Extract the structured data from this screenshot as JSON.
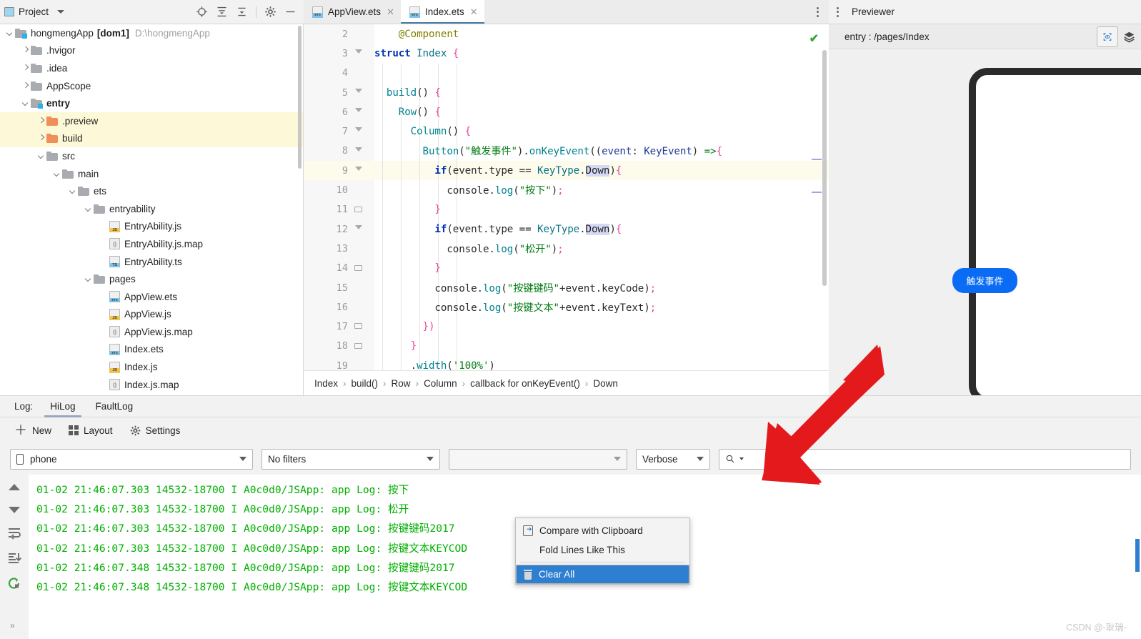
{
  "project_panel": {
    "title": "Project",
    "toolbar_icons": [
      "locate-icon",
      "expand-all-icon",
      "collapse-all-icon",
      "settings-gear-icon",
      "minimize-icon"
    ],
    "tree": [
      {
        "depth": 0,
        "arrow": "down",
        "icon": "folder-module",
        "label": "hongmengApp",
        "bold_suffix": "[dom1]",
        "path": "D:\\hongmengApp",
        "highlight": false
      },
      {
        "depth": 1,
        "arrow": "right",
        "icon": "folder",
        "label": ".hvigor",
        "highlight": false
      },
      {
        "depth": 1,
        "arrow": "right",
        "icon": "folder",
        "label": ".idea",
        "highlight": false
      },
      {
        "depth": 1,
        "arrow": "right",
        "icon": "folder",
        "label": "AppScope",
        "highlight": false
      },
      {
        "depth": 1,
        "arrow": "down",
        "icon": "folder-module",
        "label": "entry",
        "bold": true,
        "highlight": false
      },
      {
        "depth": 2,
        "arrow": "right",
        "icon": "folder-orange",
        "label": ".preview",
        "highlight": true
      },
      {
        "depth": 2,
        "arrow": "right",
        "icon": "folder-orange",
        "label": "build",
        "highlight": true
      },
      {
        "depth": 2,
        "arrow": "down",
        "icon": "folder",
        "label": "src",
        "highlight": false
      },
      {
        "depth": 3,
        "arrow": "down",
        "icon": "folder",
        "label": "main",
        "highlight": false
      },
      {
        "depth": 4,
        "arrow": "down",
        "icon": "folder",
        "label": "ets",
        "highlight": false
      },
      {
        "depth": 5,
        "arrow": "down",
        "icon": "folder",
        "label": "entryability",
        "highlight": false
      },
      {
        "depth": 6,
        "arrow": "none",
        "icon": "file-js",
        "label": "EntryAbility.js",
        "highlight": false
      },
      {
        "depth": 6,
        "arrow": "none",
        "icon": "file-map",
        "label": "EntryAbility.js.map",
        "highlight": false
      },
      {
        "depth": 6,
        "arrow": "none",
        "icon": "file-ts",
        "label": "EntryAbility.ts",
        "highlight": false
      },
      {
        "depth": 5,
        "arrow": "down",
        "icon": "folder",
        "label": "pages",
        "highlight": false
      },
      {
        "depth": 6,
        "arrow": "none",
        "icon": "file-ets",
        "label": "AppView.ets",
        "highlight": false
      },
      {
        "depth": 6,
        "arrow": "none",
        "icon": "file-js",
        "label": "AppView.js",
        "highlight": false
      },
      {
        "depth": 6,
        "arrow": "none",
        "icon": "file-map",
        "label": "AppView.js.map",
        "highlight": false
      },
      {
        "depth": 6,
        "arrow": "none",
        "icon": "file-ets",
        "label": "Index.ets",
        "highlight": false
      },
      {
        "depth": 6,
        "arrow": "none",
        "icon": "file-js",
        "label": "Index.js",
        "highlight": false
      },
      {
        "depth": 6,
        "arrow": "none",
        "icon": "file-map",
        "label": "Index.js.map",
        "highlight": false
      }
    ]
  },
  "editor": {
    "tabs": [
      {
        "label": "AppView.ets",
        "icon": "ets-file-icon",
        "active": false
      },
      {
        "label": "Index.ets",
        "icon": "ets-file-icon",
        "active": true
      }
    ],
    "status_ok": "✔",
    "lines": [
      {
        "num": "2",
        "fold": "none",
        "current": false,
        "tokens": [
          {
            "t": "    ",
            "c": "plain"
          },
          {
            "t": "@Component",
            "c": "ann"
          }
        ]
      },
      {
        "num": "3",
        "fold": "tri",
        "current": false,
        "tokens": [
          {
            "t": "struct",
            "c": "kw"
          },
          {
            "t": " ",
            "c": "plain"
          },
          {
            "t": "Index",
            "c": "type"
          },
          {
            "t": " ",
            "c": "plain"
          },
          {
            "t": "{",
            "c": "brk"
          }
        ]
      },
      {
        "num": "4",
        "fold": "none",
        "current": false,
        "tokens": []
      },
      {
        "num": "5",
        "fold": "tri",
        "current": false,
        "tokens": [
          {
            "t": "  ",
            "c": "plain"
          },
          {
            "t": "build",
            "c": "fn"
          },
          {
            "t": "() ",
            "c": "plain"
          },
          {
            "t": "{",
            "c": "brk"
          }
        ]
      },
      {
        "num": "6",
        "fold": "tri",
        "current": false,
        "tokens": [
          {
            "t": "    ",
            "c": "plain"
          },
          {
            "t": "Row",
            "c": "fn"
          },
          {
            "t": "() ",
            "c": "plain"
          },
          {
            "t": "{",
            "c": "brk"
          }
        ]
      },
      {
        "num": "7",
        "fold": "tri",
        "current": false,
        "tokens": [
          {
            "t": "      ",
            "c": "plain"
          },
          {
            "t": "Column",
            "c": "fn"
          },
          {
            "t": "() ",
            "c": "plain"
          },
          {
            "t": "{",
            "c": "brk"
          }
        ]
      },
      {
        "num": "8",
        "fold": "tri",
        "current": false,
        "tokens": [
          {
            "t": "        ",
            "c": "plain"
          },
          {
            "t": "Button",
            "c": "fn"
          },
          {
            "t": "(",
            "c": "plain"
          },
          {
            "t": "\"触发事件\"",
            "c": "str"
          },
          {
            "t": ").",
            "c": "plain"
          },
          {
            "t": "onKeyEvent",
            "c": "fn"
          },
          {
            "t": "((",
            "c": "plain"
          },
          {
            "t": "event",
            "c": "id"
          },
          {
            "t": ": ",
            "c": "plain"
          },
          {
            "t": "KeyEvent",
            "c": "id"
          },
          {
            "t": ") ",
            "c": "plain"
          },
          {
            "t": "=>",
            "c": "arr"
          },
          {
            "t": "{",
            "c": "brk"
          }
        ]
      },
      {
        "num": "9",
        "fold": "tri",
        "current": true,
        "tokens": [
          {
            "t": "          ",
            "c": "plain"
          },
          {
            "t": "if",
            "c": "kw"
          },
          {
            "t": "(",
            "c": "plain"
          },
          {
            "t": "event",
            "c": "plain"
          },
          {
            "t": ".",
            "c": "plain"
          },
          {
            "t": "type",
            "c": "plain"
          },
          {
            "t": " == ",
            "c": "plain"
          },
          {
            "t": "KeyType",
            "c": "type"
          },
          {
            "t": ".",
            "c": "plain"
          },
          {
            "t": "Down",
            "c": "sel"
          },
          {
            "t": ")",
            "c": "plain"
          },
          {
            "t": "{",
            "c": "brk"
          }
        ]
      },
      {
        "num": "10",
        "fold": "none",
        "current": false,
        "tokens": [
          {
            "t": "            ",
            "c": "plain"
          },
          {
            "t": "console",
            "c": "plain"
          },
          {
            "t": ".",
            "c": "plain"
          },
          {
            "t": "log",
            "c": "fn"
          },
          {
            "t": "(",
            "c": "plain"
          },
          {
            "t": "\"按下\"",
            "c": "str"
          },
          {
            "t": ")",
            "c": "plain"
          },
          {
            "t": ";",
            "c": "brk"
          }
        ]
      },
      {
        "num": "11",
        "fold": "minus",
        "current": false,
        "tokens": [
          {
            "t": "          ",
            "c": "plain"
          },
          {
            "t": "}",
            "c": "brk"
          }
        ]
      },
      {
        "num": "12",
        "fold": "tri",
        "current": false,
        "tokens": [
          {
            "t": "          ",
            "c": "plain"
          },
          {
            "t": "if",
            "c": "kw"
          },
          {
            "t": "(",
            "c": "plain"
          },
          {
            "t": "event",
            "c": "plain"
          },
          {
            "t": ".",
            "c": "plain"
          },
          {
            "t": "type",
            "c": "plain"
          },
          {
            "t": " == ",
            "c": "plain"
          },
          {
            "t": "KeyType",
            "c": "type"
          },
          {
            "t": ".",
            "c": "plain"
          },
          {
            "t": "Down",
            "c": "sel"
          },
          {
            "t": ")",
            "c": "plain"
          },
          {
            "t": "{",
            "c": "brk"
          }
        ]
      },
      {
        "num": "13",
        "fold": "none",
        "current": false,
        "tokens": [
          {
            "t": "            ",
            "c": "plain"
          },
          {
            "t": "console",
            "c": "plain"
          },
          {
            "t": ".",
            "c": "plain"
          },
          {
            "t": "log",
            "c": "fn"
          },
          {
            "t": "(",
            "c": "plain"
          },
          {
            "t": "\"松开\"",
            "c": "str"
          },
          {
            "t": ")",
            "c": "plain"
          },
          {
            "t": ";",
            "c": "brk"
          }
        ]
      },
      {
        "num": "14",
        "fold": "minus",
        "current": false,
        "tokens": [
          {
            "t": "          ",
            "c": "plain"
          },
          {
            "t": "}",
            "c": "brk"
          }
        ]
      },
      {
        "num": "15",
        "fold": "none",
        "current": false,
        "tokens": [
          {
            "t": "          ",
            "c": "plain"
          },
          {
            "t": "console",
            "c": "plain"
          },
          {
            "t": ".",
            "c": "plain"
          },
          {
            "t": "log",
            "c": "fn"
          },
          {
            "t": "(",
            "c": "plain"
          },
          {
            "t": "\"按键键码\"",
            "c": "str"
          },
          {
            "t": "+",
            "c": "plain"
          },
          {
            "t": "event",
            "c": "plain"
          },
          {
            "t": ".",
            "c": "plain"
          },
          {
            "t": "keyCode",
            "c": "plain"
          },
          {
            "t": ")",
            "c": "plain"
          },
          {
            "t": ";",
            "c": "brk"
          }
        ]
      },
      {
        "num": "16",
        "fold": "none",
        "current": false,
        "tokens": [
          {
            "t": "          ",
            "c": "plain"
          },
          {
            "t": "console",
            "c": "plain"
          },
          {
            "t": ".",
            "c": "plain"
          },
          {
            "t": "log",
            "c": "fn"
          },
          {
            "t": "(",
            "c": "plain"
          },
          {
            "t": "\"按键文本\"",
            "c": "str"
          },
          {
            "t": "+",
            "c": "plain"
          },
          {
            "t": "event",
            "c": "plain"
          },
          {
            "t": ".",
            "c": "plain"
          },
          {
            "t": "keyText",
            "c": "plain"
          },
          {
            "t": ")",
            "c": "plain"
          },
          {
            "t": ";",
            "c": "brk"
          }
        ]
      },
      {
        "num": "17",
        "fold": "minus",
        "current": false,
        "tokens": [
          {
            "t": "        ",
            "c": "plain"
          },
          {
            "t": "})",
            "c": "brk"
          }
        ]
      },
      {
        "num": "18",
        "fold": "minus",
        "current": false,
        "tokens": [
          {
            "t": "      ",
            "c": "plain"
          },
          {
            "t": "}",
            "c": "brk"
          }
        ]
      },
      {
        "num": "19",
        "fold": "none",
        "current": false,
        "tokens": [
          {
            "t": "      .",
            "c": "plain"
          },
          {
            "t": "width",
            "c": "fn"
          },
          {
            "t": "(",
            "c": "plain"
          },
          {
            "t": "'100%'",
            "c": "str"
          },
          {
            "t": ")",
            "c": "plain"
          }
        ]
      }
    ],
    "breadcrumb": [
      "Index",
      "build()",
      "Row",
      "Column",
      "callback for onKeyEvent()",
      "Down"
    ]
  },
  "previewer": {
    "title": "Previewer",
    "route": "entry : /pages/Index",
    "toolbar_icons": [
      "inspector-icon",
      "layers-icon"
    ],
    "device_button_label": "触发事件"
  },
  "log_panel": {
    "label": "Log:",
    "tabs": [
      {
        "label": "HiLog",
        "active": true
      },
      {
        "label": "FaultLog",
        "active": false
      }
    ],
    "tools": [
      {
        "label": "New",
        "icon": "plus-icon"
      },
      {
        "label": "Layout",
        "icon": "layout-grid-icon"
      },
      {
        "label": "Settings",
        "icon": "gear-icon"
      }
    ],
    "filters": {
      "device": "phone",
      "device_icon": "phone-icon",
      "filter": "No filters",
      "process": "",
      "level": "Verbose",
      "search_value": "",
      "search_icon": "search-icon"
    },
    "rail_icons": [
      "scroll-up-icon",
      "scroll-down-icon",
      "soft-wrap-icon",
      "scroll-to-end-icon",
      "restart-icon"
    ],
    "lines": [
      "01-02 21:46:07.303 14532-18700 I A0c0d0/JSApp: app Log: 按下",
      "01-02 21:46:07.303 14532-18700 I A0c0d0/JSApp: app Log: 松开",
      "01-02 21:46:07.303 14532-18700 I A0c0d0/JSApp: app Log: 按键键码2017",
      "01-02 21:46:07.303 14532-18700 I A0c0d0/JSApp: app Log: 按键文本KEYCOD",
      "01-02 21:46:07.348 14532-18700 I A0c0d0/JSApp: app Log: 按键键码2017",
      "01-02 21:46:07.348 14532-18700 I A0c0d0/JSApp: app Log: 按键文本KEYCOD"
    ]
  },
  "context_menu": {
    "items": [
      {
        "label": "Compare with Clipboard",
        "icon": "clipboard-compare-icon",
        "selected": false,
        "mnemonic": "b"
      },
      {
        "label": "Fold Lines Like This",
        "icon": "none",
        "selected": false
      },
      {
        "label": "Clear All",
        "icon": "trash-icon",
        "selected": true
      }
    ]
  },
  "annotation": {
    "arrow_color": "#e3191c"
  },
  "watermark": "CSDN @-耿瑞-",
  "status_bar": {
    "expand_chevron": "»"
  }
}
